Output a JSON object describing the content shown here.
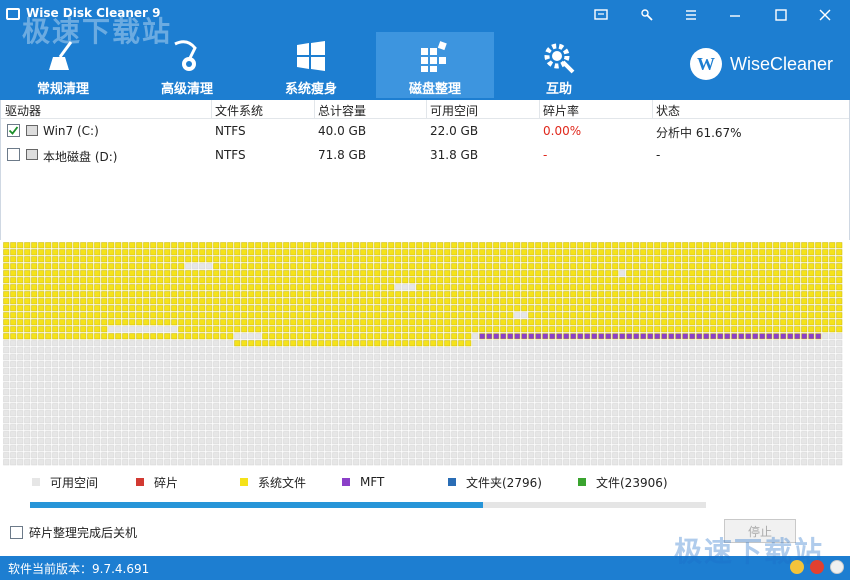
{
  "window": {
    "title": "Wise Disk Cleaner 9",
    "watermark": "极速下载站"
  },
  "nav": {
    "tabs": [
      {
        "label": "常规清理",
        "icon": "broom-icon"
      },
      {
        "label": "高级清理",
        "icon": "vacuum-icon"
      },
      {
        "label": "系统瘦身",
        "icon": "windows-icon"
      },
      {
        "label": "磁盘整理",
        "icon": "defrag-blocks-icon",
        "active": true
      },
      {
        "label": "互助",
        "icon": "gear-wrench-icon"
      }
    ]
  },
  "brand": {
    "logo_letter": "W",
    "name": "WiseCleaner"
  },
  "table": {
    "headers": [
      "驱动器",
      "文件系统",
      "总计容量",
      "可用空间",
      "碎片率",
      "状态"
    ],
    "rows": [
      {
        "checked": true,
        "drive": "Win7 (C:)",
        "fs": "NTFS",
        "total": "40.0 GB",
        "free": "22.0 GB",
        "frag": "0.00%",
        "status": "分析中 61.67%"
      },
      {
        "checked": false,
        "drive": "本地磁盘 (D:)",
        "fs": "NTFS",
        "total": "71.8 GB",
        "free": "31.8 GB",
        "frag": "-",
        "status": "-"
      }
    ]
  },
  "legend": [
    {
      "label": "可用空间",
      "color": "#e6e6e6"
    },
    {
      "label": "碎片",
      "color": "#d23a32"
    },
    {
      "label": "系统文件",
      "color": "#f5e21a"
    },
    {
      "label": "MFT",
      "color": "#8b3fc8"
    },
    {
      "label": "文件夹(2796)",
      "color": "#2a6db5"
    },
    {
      "label": "文件(23906)",
      "color": "#3aa42f"
    }
  ],
  "progress": {
    "percent": 67
  },
  "controls": {
    "shutdown_label": "碎片整理完成后关机",
    "stop_label": "停止"
  },
  "statusbar": {
    "version": "软件当前版本：9.7.4.691"
  }
}
